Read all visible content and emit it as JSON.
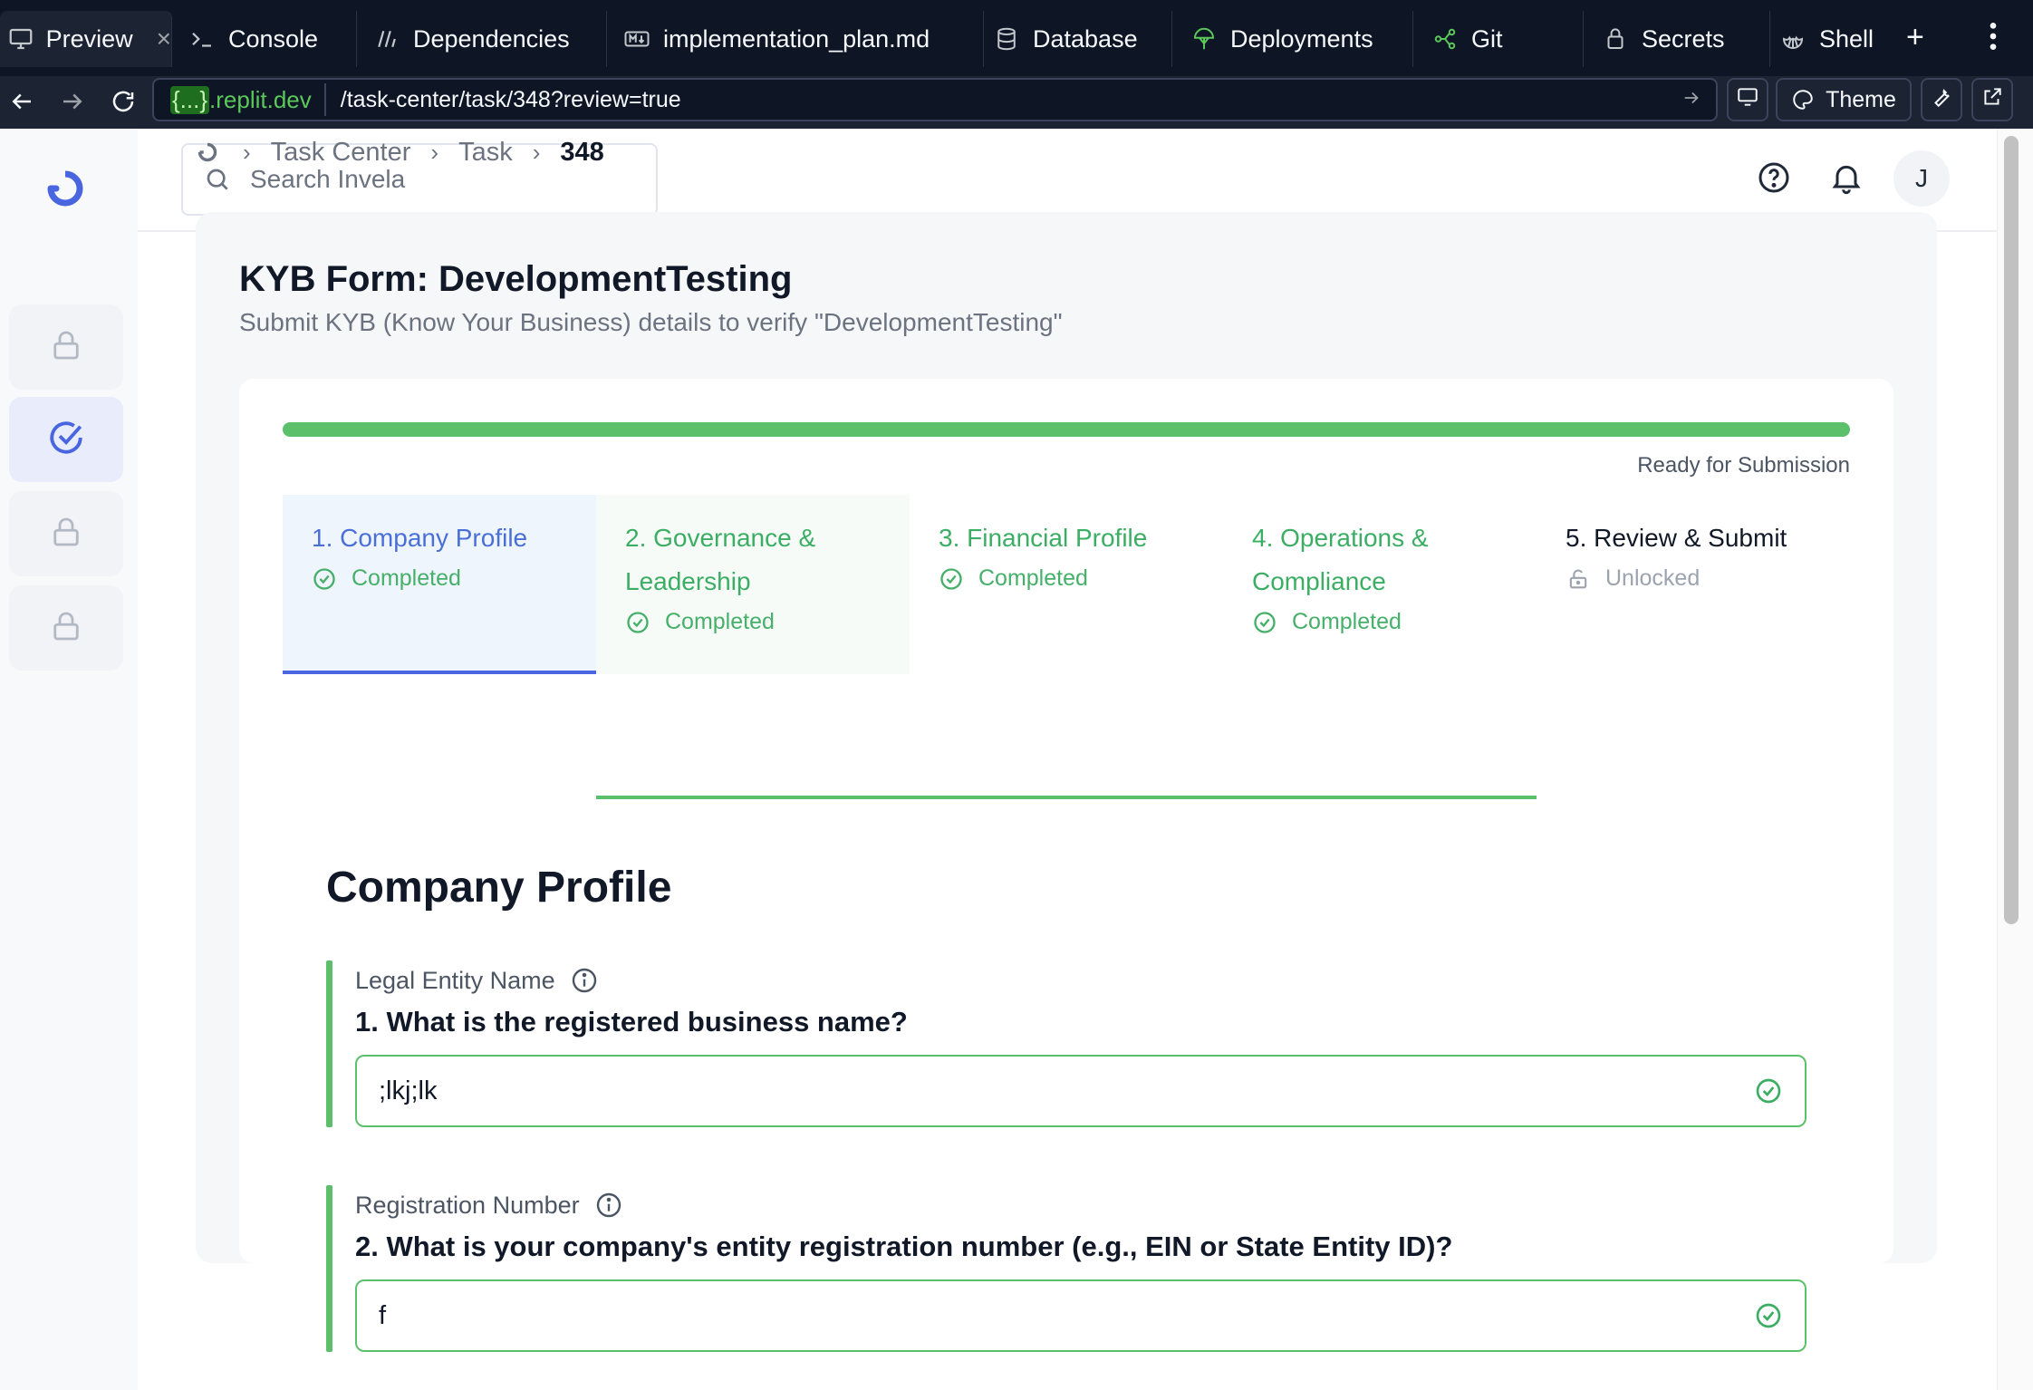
{
  "tabs": [
    {
      "label": "Preview",
      "icon": "monitor-icon",
      "active": true
    },
    {
      "label": "Console",
      "icon": "terminal-icon"
    },
    {
      "label": "Dependencies",
      "icon": "dependencies-icon"
    },
    {
      "label": "implementation_plan.md",
      "icon": "markdown-icon"
    },
    {
      "label": "Database",
      "icon": "database-icon"
    },
    {
      "label": "Deployments",
      "icon": "deployments-icon"
    },
    {
      "label": "Git",
      "icon": "git-icon"
    },
    {
      "label": "Secrets",
      "icon": "lock-icon"
    },
    {
      "label": "Shell",
      "icon": "shell-icon"
    }
  ],
  "tab_close": "×",
  "tab_plus": "+",
  "url": {
    "domain_brace": "{...}",
    "domain_rest": ".replit.dev",
    "path": "/task-center/task/348?review=true",
    "theme_label": "Theme"
  },
  "header": {
    "search_placeholder": "Search Invela",
    "avatar_initial": "J"
  },
  "breadcrumb": {
    "items": [
      "Task Center",
      "Task"
    ],
    "current": "348"
  },
  "form": {
    "title": "KYB Form: DevelopmentTesting",
    "subtitle": "Submit KYB (Know Your Business) details to verify \"DevelopmentTesting\"",
    "progress_percent": 100,
    "progress_label": "Ready for Submission",
    "progress_color": "#5cc06a"
  },
  "steps": [
    {
      "title": "1. Company Profile",
      "status": "Completed"
    },
    {
      "title": "2. Governance & Leadership",
      "status": "Completed"
    },
    {
      "title": "3. Financial Profile",
      "status": "Completed"
    },
    {
      "title": "4. Operations & Compliance",
      "status": "Completed"
    },
    {
      "title": "5. Review & Submit",
      "status": "Unlocked"
    }
  ],
  "section": {
    "title": "Company Profile",
    "questions": [
      {
        "label": "Legal Entity Name",
        "question": "1. What is the registered business name?",
        "value": ";lkj;lk"
      },
      {
        "label": "Registration Number",
        "question": "2. What is your company's entity registration number (e.g., EIN or State Entity ID)?",
        "value": "f"
      }
    ]
  },
  "colors": {
    "accent_blue": "#4965e0",
    "success_green": "#5cc06a",
    "chrome_bg": "#0e1525"
  }
}
